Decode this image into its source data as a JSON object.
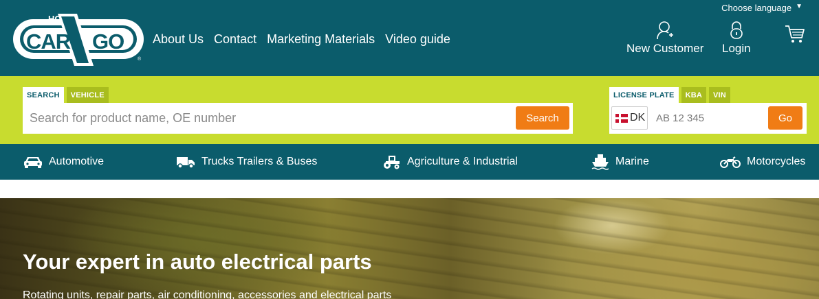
{
  "header": {
    "logo_text": "HC CARGO",
    "nav": [
      "About Us",
      "Contact",
      "Marketing Materials",
      "Video guide"
    ],
    "language_label": "Choose language",
    "new_customer_label": "New Customer",
    "login_label": "Login",
    "cart_icon": "shopping-cart-icon"
  },
  "search": {
    "tabs": [
      "SEARCH",
      "VEHICLE"
    ],
    "placeholder": "Search for product name, OE number",
    "button_label": "Search"
  },
  "plate": {
    "tabs": [
      "LICENSE PLATE",
      "KBA",
      "VIN"
    ],
    "country_code": "DK",
    "placeholder": "AB 12 345",
    "button_label": "Go"
  },
  "categories": [
    {
      "label": "Automotive",
      "icon": "car-icon"
    },
    {
      "label": "Trucks Trailers & Buses",
      "icon": "truck-icon"
    },
    {
      "label": "Agriculture & Industrial",
      "icon": "tractor-icon"
    },
    {
      "label": "Marine",
      "icon": "ship-icon"
    },
    {
      "label": "Motorcycles",
      "icon": "motorcycle-icon"
    }
  ],
  "hero": {
    "title": "Your expert in auto electrical parts",
    "subtitle": "Rotating units, repair parts, air conditioning, accessories and electrical parts"
  },
  "colors": {
    "header_bg": "#0b5c6b",
    "search_band_bg": "#c8dc2f",
    "accent_orange": "#f07c15"
  }
}
